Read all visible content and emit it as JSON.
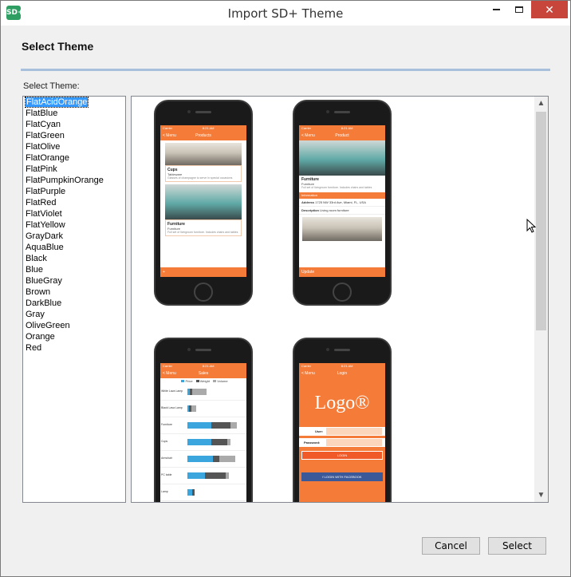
{
  "window": {
    "title": "Import SD+ Theme",
    "icon_text": "SD+",
    "close_glyph": "✕"
  },
  "header": {
    "title": "Select Theme"
  },
  "list": {
    "label": "Select Theme:",
    "items": [
      "FlatAcidOrange",
      "FlatBlue",
      "FlatCyan",
      "FlatGreen",
      "FlatOlive",
      "FlatOrange",
      "FlatPink",
      "FlatPumpkinOrange",
      "FlatPurple",
      "FlatRed",
      "FlatViolet",
      "FlatYellow",
      "GrayDark",
      "AquaBlue",
      "Black",
      "Blue",
      "BlueGray",
      "Brown",
      "DarkBlue",
      "Gray",
      "OliveGreen",
      "Orange",
      "Red"
    ],
    "selected": "FlatAcidOrange"
  },
  "previews": {
    "accent_color": "#f47b38",
    "status": {
      "carrier": "Carrier",
      "time": "8:21 AM"
    },
    "products": {
      "back": "< Menu",
      "title": "Products",
      "item1": {
        "name": "Cups",
        "category": "Tableware",
        "desc": "Glasses of champagne to serve in special occasions"
      },
      "item2": {
        "name": "Furniture",
        "category": "Furniture",
        "desc": "Full set of livingroom furniture. Includes chairs and tables"
      }
    },
    "product": {
      "back": "< Menu",
      "title": "Product",
      "name": "Furniture",
      "category": "Furniture",
      "desc": "Full set of livingroom furniture. Includes chairs and tables",
      "info_header": "Information",
      "address_label": "Address",
      "address_value": "1725 NW 33rd Ave, Miami, FL, USA",
      "description_label": "Description",
      "description_value": "Living room furniture",
      "photo_label": "Photo",
      "update": "Update"
    },
    "sales": {
      "back": "< Menu",
      "title": "Sales",
      "legend": [
        "Price",
        "Weight",
        "Volume"
      ],
      "legend_colors": [
        "#3aa6dd",
        "#555555",
        "#aaaaaa"
      ],
      "rows": [
        "White Lava Lamp",
        "Black Lava Lamp",
        "Furniture",
        "Cups",
        "Armchair",
        "PC table",
        "Lamp"
      ]
    },
    "login": {
      "back": "< Menu",
      "title": "Login",
      "logo": "Logo®",
      "user_label": "User:",
      "password_label": "Password:",
      "login_button": "LOGIN",
      "facebook_button": "LOGIN WITH FACEBOOK"
    }
  },
  "buttons": {
    "cancel": "Cancel",
    "select": "Select"
  }
}
